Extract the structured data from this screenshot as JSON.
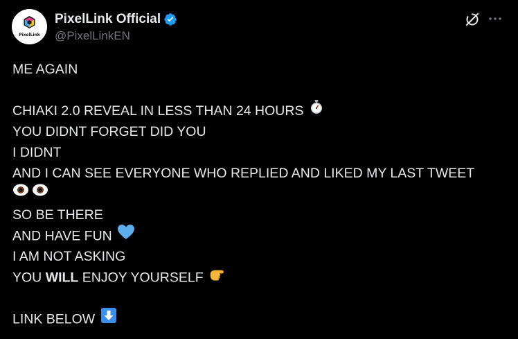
{
  "author": {
    "display_name": "PixelLink Official",
    "handle": "@PixelLinkEN",
    "avatar_text": "PixelLink",
    "verified": true,
    "verified_color": "#1d9bf0"
  },
  "tweet": {
    "line1": "ME AGAIN",
    "line2": "CHIAKI 2.0 REVEAL IN LESS THAN 24 HOURS",
    "line3": "YOU DIDNT FORGET DID YOU",
    "line4": "I DIDNT",
    "line5": "AND I CAN SEE EVERYONE WHO REPLIED AND LIKED MY LAST TWEET",
    "line7": "SO BE THERE",
    "line8": "AND HAVE FUN",
    "line9": "I AM NOT ASKING",
    "line10_pre": "YOU",
    "line10_bold": "WILL",
    "line10_post": "ENJOY YOURSELF",
    "line11": "LINK BELOW"
  },
  "icons": {
    "stopwatch": "stopwatch-emoji",
    "eyes": "eyes-emoji",
    "heart": "blue-heart-emoji",
    "pointing": "pointing-hand-emoji",
    "down_arrow": "down-arrow-emoji",
    "grok": "grok-icon",
    "more": "more-icon"
  },
  "colors": {
    "background": "#000000",
    "text": "#e7e9ea",
    "secondary": "#71767b",
    "accent": "#1d9bf0",
    "heart": "#5dadec"
  }
}
